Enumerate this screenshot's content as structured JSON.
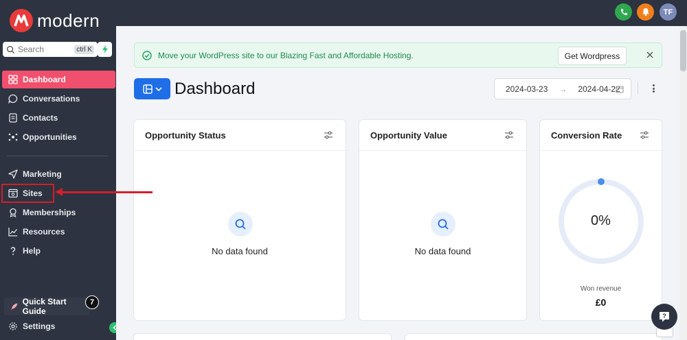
{
  "app": {
    "brand": "modern",
    "brand_color": "#e93b3b",
    "accent_color": "#1f6ee8",
    "active_nav_color": "#f0506e"
  },
  "sidebar": {
    "search": {
      "placeholder": "Search",
      "shortcut": "ctrl K"
    },
    "items": [
      {
        "label": "Dashboard",
        "icon": "dashboard-icon",
        "active": true
      },
      {
        "label": "Conversations",
        "icon": "chat-icon"
      },
      {
        "label": "Contacts",
        "icon": "contacts-icon"
      },
      {
        "label": "Opportunities",
        "icon": "opportunities-icon"
      },
      {
        "label": "Marketing",
        "icon": "send-icon"
      },
      {
        "label": "Sites",
        "icon": "sites-icon"
      },
      {
        "label": "Memberships",
        "icon": "badge-icon"
      },
      {
        "label": "Resources",
        "icon": "chart-line-icon"
      },
      {
        "label": "Help",
        "icon": "question-icon"
      }
    ],
    "quick_start": {
      "label": "Quick Start Guide",
      "badge": "7"
    },
    "settings": {
      "label": "Settings"
    }
  },
  "topbar": {
    "avatar_initials": "TF",
    "phone_color": "#2fa84f",
    "bell_color": "#f07f1a",
    "avatar_color": "#7b8ab8"
  },
  "banner": {
    "text": "Move your WordPress site to our Blazing Fast and Affordable Hosting.",
    "button": "Get Wordpress"
  },
  "header": {
    "title": "Dashboard",
    "date_start": "2024-03-23",
    "date_end": "2024-04-22"
  },
  "cards": {
    "opportunity_status": {
      "title": "Opportunity Status",
      "empty_text": "No data found"
    },
    "opportunity_value": {
      "title": "Opportunity Value",
      "empty_text": "No data found"
    },
    "conversion_rate": {
      "title": "Conversion Rate",
      "value": "0%",
      "won_label": "Won revenue",
      "won_value": "£0"
    }
  }
}
